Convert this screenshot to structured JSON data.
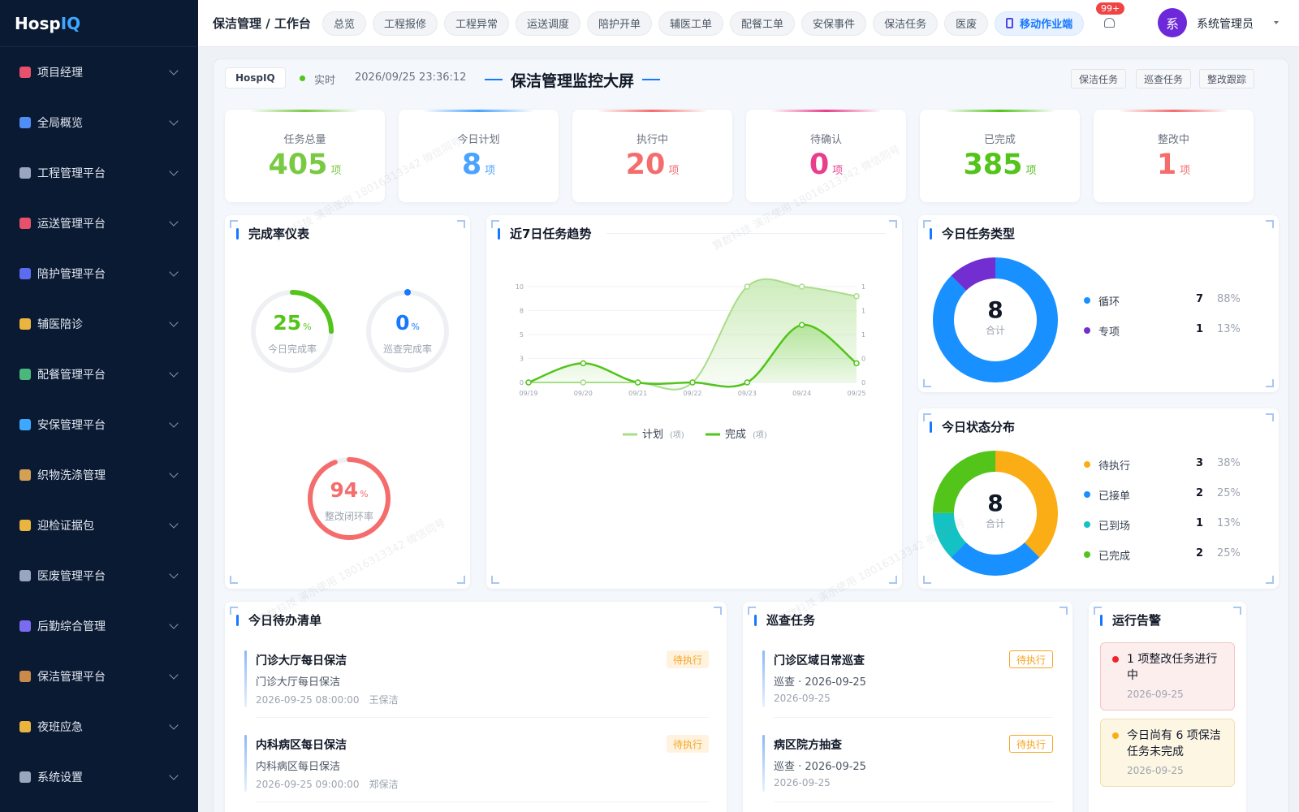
{
  "app": {
    "logo_main": "Hosp",
    "logo_accent": "IQ"
  },
  "sidebar": {
    "items": [
      {
        "label": "项目经理",
        "icon": "target-icon",
        "color": "#e8506b"
      },
      {
        "label": "全局概览",
        "icon": "chart-icon",
        "color": "#4f8ef7"
      },
      {
        "label": "工程管理平台",
        "icon": "building-icon",
        "color": "#9aa6bd"
      },
      {
        "label": "运送管理平台",
        "icon": "truck-icon",
        "color": "#e8506b"
      },
      {
        "label": "陪护管理平台",
        "icon": "bed-icon",
        "color": "#5b6cf0"
      },
      {
        "label": "辅医陪诊",
        "icon": "heart-icon",
        "color": "#e9b53f"
      },
      {
        "label": "配餐管理平台",
        "icon": "food-icon",
        "color": "#49b87a"
      },
      {
        "label": "安保管理平台",
        "icon": "shield-icon",
        "color": "#3ea8ff"
      },
      {
        "label": "织物洗涤管理",
        "icon": "basket-icon",
        "color": "#d4a054"
      },
      {
        "label": "迎检证据包",
        "icon": "folder-icon",
        "color": "#e9b53f"
      },
      {
        "label": "医废管理平台",
        "icon": "trash-icon",
        "color": "#9aa6bd"
      },
      {
        "label": "后勤综合管理",
        "icon": "users-icon",
        "color": "#7a6cf0"
      },
      {
        "label": "保洁管理平台",
        "icon": "broom-icon",
        "color": "#c98a4a"
      },
      {
        "label": "夜班应急",
        "icon": "moon-icon",
        "color": "#e9b53f"
      },
      {
        "label": "系统设置",
        "icon": "gear-icon",
        "color": "#9aa6bd"
      }
    ]
  },
  "header": {
    "breadcrumb": "保洁管理 / 工作台",
    "tabs": [
      "总览",
      "工程报修",
      "工程异常",
      "运送调度",
      "陪护开单",
      "辅医工单",
      "配餐工单",
      "安保事件",
      "保洁任务",
      "医废"
    ],
    "active_tab": "移动作业端",
    "notification_badge": "99+",
    "avatar_text": "系",
    "user_name": "系统管理员"
  },
  "screen": {
    "brand": "HospIQ",
    "live_label": "实时",
    "timestamp": "2026/09/25 23:36:12",
    "title": "保洁管理监控大屏",
    "buttons": [
      "保洁任务",
      "巡查任务",
      "整改跟踪"
    ]
  },
  "stats": [
    {
      "label": "任务总量",
      "value": "405",
      "unit": "项",
      "color": "#7ac943"
    },
    {
      "label": "今日计划",
      "value": "8",
      "unit": "项",
      "color": "#4aa3ff"
    },
    {
      "label": "执行中",
      "value": "20",
      "unit": "项",
      "color": "#f56c6c"
    },
    {
      "label": "待确认",
      "value": "0",
      "unit": "项",
      "color": "#e83e8c"
    },
    {
      "label": "已完成",
      "value": "385",
      "unit": "项",
      "color": "#52c41a"
    },
    {
      "label": "整改中",
      "value": "1",
      "unit": "项",
      "color": "#f56c6c"
    }
  ],
  "gauges_panel": {
    "title": "完成率仪表",
    "gauges": [
      {
        "value": "25",
        "percent": 25,
        "unit": "%",
        "label": "今日完成率",
        "color": "#52c41a"
      },
      {
        "value": "0",
        "percent": 0,
        "unit": "%",
        "label": "巡查完成率",
        "color": "#1677ff"
      },
      {
        "value": "94",
        "percent": 94,
        "unit": "%",
        "label": "整改闭环率",
        "color": "#f56c6c"
      }
    ]
  },
  "trend_panel": {
    "title": "近7日任务趋势"
  },
  "chart_data": {
    "type": "area",
    "x": [
      "09/19",
      "09/20",
      "09/21",
      "09/22",
      "09/23",
      "09/24",
      "09/25"
    ],
    "series": [
      {
        "name": "计划",
        "unit": "(项)",
        "values": [
          0,
          0,
          0,
          0,
          10,
          10,
          9
        ],
        "color": "#a8dd8a"
      },
      {
        "name": "完成",
        "unit": "(项)",
        "values": [
          0,
          0.2,
          0,
          0,
          0,
          0.6,
          0.2
        ],
        "color": "#52c41a"
      }
    ],
    "y_left_ticks": [
      "0",
      "3",
      "5",
      "8",
      "10"
    ],
    "y_right_ticks": [
      "0",
      "0",
      "1",
      "1",
      "1"
    ],
    "ylim_left": [
      0,
      10
    ],
    "ylim_right": [
      0,
      1
    ],
    "grid": true,
    "legend": "bottom"
  },
  "type_panel": {
    "title": "今日任务类型",
    "total": "8",
    "total_label": "合计",
    "items": [
      {
        "name": "循环",
        "count": "7",
        "pct": "88%",
        "value": 7,
        "color": "#1890ff"
      },
      {
        "name": "专项",
        "count": "1",
        "pct": "13%",
        "value": 1,
        "color": "#722ed1"
      }
    ]
  },
  "status_panel": {
    "title": "今日状态分布",
    "total": "8",
    "total_label": "合计",
    "items": [
      {
        "name": "待执行",
        "count": "3",
        "pct": "38%",
        "value": 3,
        "color": "#faad14"
      },
      {
        "name": "已接单",
        "count": "2",
        "pct": "25%",
        "value": 2,
        "color": "#1890ff"
      },
      {
        "name": "已到场",
        "count": "1",
        "pct": "13%",
        "value": 1,
        "color": "#13c2c2"
      },
      {
        "name": "已完成",
        "count": "2",
        "pct": "25%",
        "value": 2,
        "color": "#52c41a"
      }
    ]
  },
  "todo_panel": {
    "title": "今日待办清单",
    "items": [
      {
        "title": "门诊大厅每日保洁",
        "sub": "门诊大厅每日保洁",
        "time": "2026-09-25 08:00:00",
        "person": "王保洁",
        "status": "待执行"
      },
      {
        "title": "内科病区每日保洁",
        "sub": "内科病区每日保洁",
        "time": "2026-09-25 09:00:00",
        "person": "郑保洁",
        "status": "待执行"
      }
    ]
  },
  "inspect_panel": {
    "title": "巡查任务",
    "items": [
      {
        "title": "门诊区域日常巡查",
        "sub": "巡查 · 2026-09-25",
        "date": "2026-09-25",
        "status": "待执行"
      },
      {
        "title": "病区院方抽查",
        "sub": "巡查 · 2026-09-25",
        "date": "2026-09-25",
        "status": "待执行"
      }
    ]
  },
  "alert_panel": {
    "title": "运行告警",
    "items": [
      {
        "text": "1 项整改任务进行中",
        "date": "2026-09-25",
        "bg": "#fdeeee",
        "border": "#f7c4c4",
        "dot": "#f5222d"
      },
      {
        "text": "今日尚有 6 项保洁任务未完成",
        "date": "2026-09-25",
        "bg": "#fdf6e3",
        "border": "#f3dfae",
        "dot": "#faad14"
      }
    ]
  },
  "watermark": {
    "text": "算数科技 演示使用 18016313342 微信同号"
  }
}
